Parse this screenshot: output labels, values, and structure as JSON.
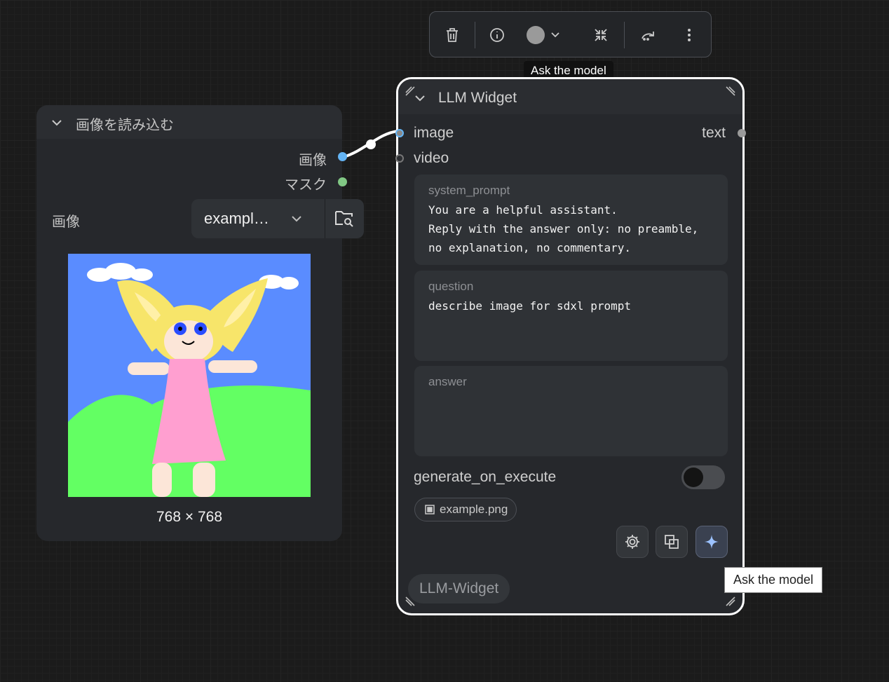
{
  "toolbar": {
    "delete_icon": "trash-icon",
    "info_icon": "info-icon",
    "color_icon": "color-dot",
    "color_value": "#9a9a9a",
    "collapse_icon": "collapse-icon",
    "bypass_icon": "redo-arrow-icon",
    "more_icon": "more-vertical-icon"
  },
  "tooltip_top": "Ask the model",
  "load_image_node": {
    "title": "画像を読み込む",
    "outputs": [
      {
        "label": "画像",
        "color": "#64b5f6"
      },
      {
        "label": "マスク",
        "color": "#81c784"
      }
    ],
    "image_field_label": "画像",
    "image_value": "exampl…",
    "dimensions": "768 × 768"
  },
  "llm_node": {
    "title": "LLM Widget",
    "inputs": [
      "image",
      "video"
    ],
    "output": "text",
    "system_prompt": {
      "label": "system_prompt",
      "text": "You are a helpful assistant.\nReply with the answer only: no preamble,\nno explanation, no commentary."
    },
    "question": {
      "label": "question",
      "text": "describe image for sdxl prompt"
    },
    "answer": {
      "label": "answer",
      "text": ""
    },
    "toggle_label": "generate_on_execute",
    "toggle_on": false,
    "file_chip": "example.png",
    "badge": "LLM-Widget"
  },
  "tooltip_bottom": "Ask the model",
  "colors": {
    "accent_blue": "#64b5f6",
    "accent_green": "#81c784",
    "node_bg": "#26282c",
    "selected_border": "#ffffff"
  }
}
